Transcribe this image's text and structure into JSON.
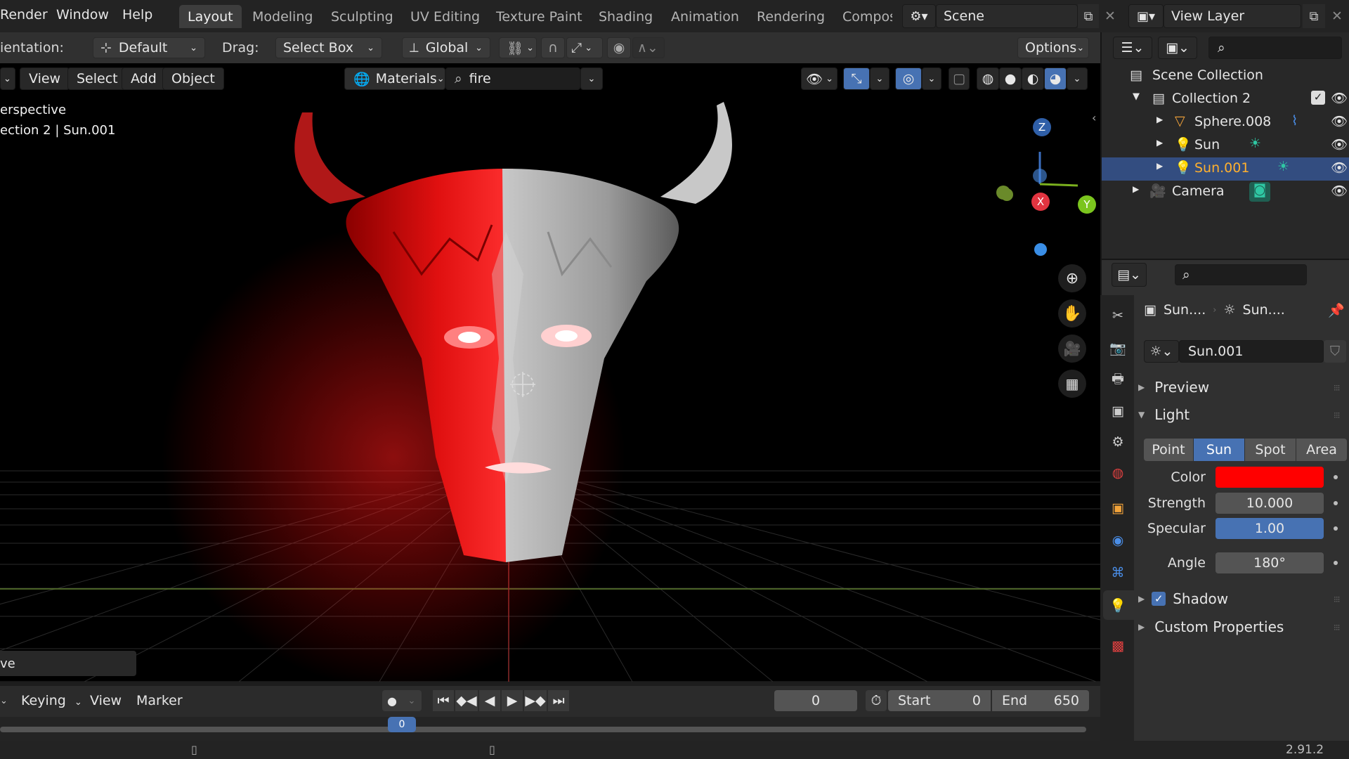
{
  "topbar": {
    "menus": [
      "Render",
      "Window",
      "Help"
    ],
    "workspaces": [
      "Layout",
      "Modeling",
      "Sculpting",
      "UV Editing",
      "Texture Paint",
      "Shading",
      "Animation",
      "Rendering",
      "Compos"
    ],
    "active_workspace": "Layout",
    "scene": "Scene",
    "view_layer": "View Layer"
  },
  "toolheader": {
    "orientation_label": "ientation:",
    "orientation_value": "Default",
    "drag_label": "Drag:",
    "drag_value": "Select Box",
    "transform_value": "Global",
    "options_label": "Options"
  },
  "viewport": {
    "menus": [
      "View",
      "Select",
      "Add",
      "Object"
    ],
    "material_filter_label": "Materials",
    "search_value": "fire",
    "overlay_text_1": "erspective",
    "overlay_text_2": "ection 2 | Sun.001",
    "operator_panel": "ve",
    "gizmo_axes": {
      "z": "Z",
      "x": "X",
      "y": "Y"
    }
  },
  "timeline": {
    "menus": [
      "Keying",
      "View",
      "Marker"
    ],
    "current_frame": "0",
    "start_label": "Start",
    "start_value": "0",
    "end_label": "End",
    "end_value": "650",
    "playhead_frame": "0"
  },
  "statusbar": {
    "version": "2.91.2"
  },
  "outliner": {
    "root": "Scene Collection",
    "items": [
      {
        "name": "Collection 2",
        "indent": 0
      },
      {
        "name": "Sphere.008",
        "indent": 1
      },
      {
        "name": "Sun",
        "indent": 1
      },
      {
        "name": "Sun.001",
        "indent": 1,
        "selected": true
      },
      {
        "name": "Camera",
        "indent": 0
      }
    ]
  },
  "properties": {
    "breadcrumb_object": "Sun....",
    "breadcrumb_data": "Sun....",
    "datablock_name": "Sun.001",
    "panels": {
      "preview": "Preview",
      "light": "Light",
      "shadow": "Shadow",
      "custom": "Custom Properties"
    },
    "light_types": [
      "Point",
      "Sun",
      "Spot",
      "Area"
    ],
    "active_light_type": "Sun",
    "fields": {
      "color_label": "Color",
      "color_value": "#ff0000",
      "strength_label": "Strength",
      "strength_value": "10.000",
      "specular_label": "Specular",
      "specular_value": "1.00",
      "angle_label": "Angle",
      "angle_value": "180°"
    },
    "shadow_enabled": true
  },
  "colors": {
    "accent": "#4772b3",
    "selection": "#334d80",
    "light_icon": "#ffb02e",
    "sun_light": "#2fc7a3",
    "sun_color": "#ff0000"
  }
}
